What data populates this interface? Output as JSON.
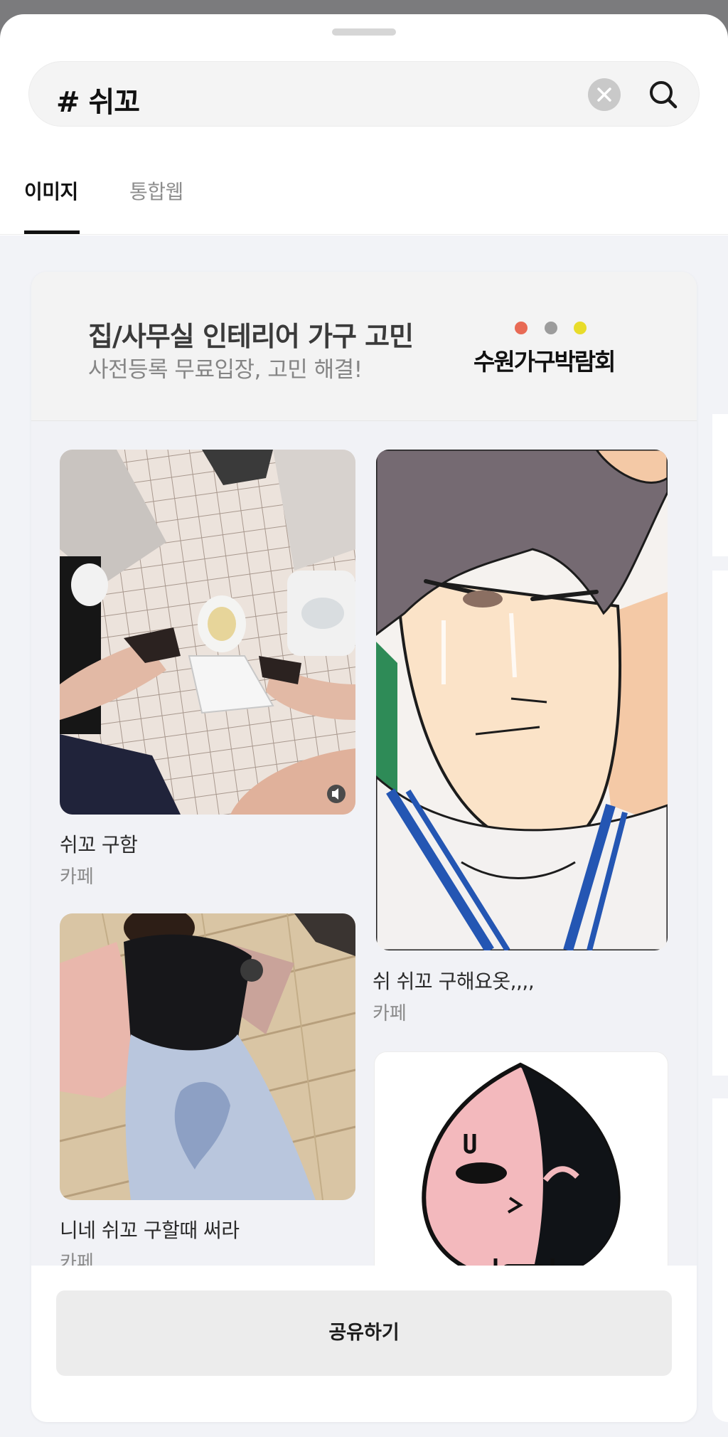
{
  "search": {
    "query": "# 쉬꼬",
    "clear_icon": "close-circle-icon",
    "search_icon": "magnifier-icon"
  },
  "tabs": [
    {
      "label": "이미지",
      "active": true
    },
    {
      "label": "통합웹",
      "active": false
    }
  ],
  "ad": {
    "title": "집/사무실 인테리어 가구 고민",
    "subtitle": "사전등록 무료입장, 고민 해결!",
    "brand": "수원가구박람회",
    "brand_dot_colors": [
      "#e86a55",
      "#9c9c9c",
      "#e8dc2a"
    ]
  },
  "results": [
    {
      "caption": "쉬꼬 구함",
      "source": "카페",
      "image": "bathroom-toilet-photo",
      "badge_icon": "sound-icon"
    },
    {
      "caption": "쉬 쉬꼬 구해요옷,,,,",
      "source": "카페",
      "image": "crying-webtoon-character"
    },
    {
      "caption": "니네 쉬꼬 구할때 써라",
      "source": "카페",
      "image": "person-lying-on-floor-photo"
    },
    {
      "caption": "",
      "source": "",
      "image": "apeach-character-illustration"
    }
  ],
  "share": {
    "label": "공유하기"
  },
  "colors": {
    "backdrop": "#7b7b7d",
    "feed_background": "#f2f3f7",
    "active_tab": "#111111",
    "inactive_tab": "#8e8e8e"
  }
}
